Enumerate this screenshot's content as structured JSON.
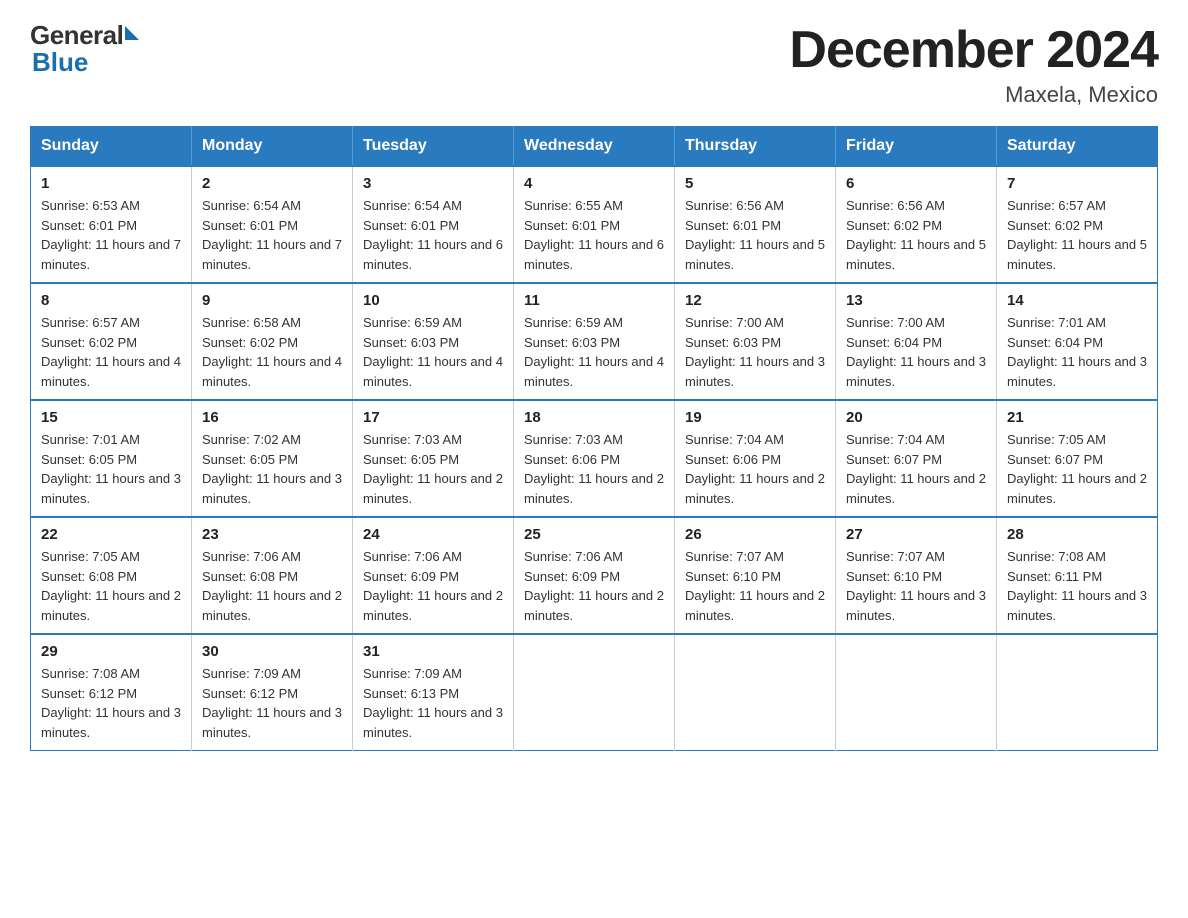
{
  "header": {
    "logo_general": "General",
    "logo_blue": "Blue",
    "title": "December 2024",
    "subtitle": "Maxela, Mexico"
  },
  "days_of_week": [
    "Sunday",
    "Monday",
    "Tuesday",
    "Wednesday",
    "Thursday",
    "Friday",
    "Saturday"
  ],
  "weeks": [
    [
      {
        "day": "1",
        "sunrise": "6:53 AM",
        "sunset": "6:01 PM",
        "daylight": "11 hours and 7 minutes."
      },
      {
        "day": "2",
        "sunrise": "6:54 AM",
        "sunset": "6:01 PM",
        "daylight": "11 hours and 7 minutes."
      },
      {
        "day": "3",
        "sunrise": "6:54 AM",
        "sunset": "6:01 PM",
        "daylight": "11 hours and 6 minutes."
      },
      {
        "day": "4",
        "sunrise": "6:55 AM",
        "sunset": "6:01 PM",
        "daylight": "11 hours and 6 minutes."
      },
      {
        "day": "5",
        "sunrise": "6:56 AM",
        "sunset": "6:01 PM",
        "daylight": "11 hours and 5 minutes."
      },
      {
        "day": "6",
        "sunrise": "6:56 AM",
        "sunset": "6:02 PM",
        "daylight": "11 hours and 5 minutes."
      },
      {
        "day": "7",
        "sunrise": "6:57 AM",
        "sunset": "6:02 PM",
        "daylight": "11 hours and 5 minutes."
      }
    ],
    [
      {
        "day": "8",
        "sunrise": "6:57 AM",
        "sunset": "6:02 PM",
        "daylight": "11 hours and 4 minutes."
      },
      {
        "day": "9",
        "sunrise": "6:58 AM",
        "sunset": "6:02 PM",
        "daylight": "11 hours and 4 minutes."
      },
      {
        "day": "10",
        "sunrise": "6:59 AM",
        "sunset": "6:03 PM",
        "daylight": "11 hours and 4 minutes."
      },
      {
        "day": "11",
        "sunrise": "6:59 AM",
        "sunset": "6:03 PM",
        "daylight": "11 hours and 4 minutes."
      },
      {
        "day": "12",
        "sunrise": "7:00 AM",
        "sunset": "6:03 PM",
        "daylight": "11 hours and 3 minutes."
      },
      {
        "day": "13",
        "sunrise": "7:00 AM",
        "sunset": "6:04 PM",
        "daylight": "11 hours and 3 minutes."
      },
      {
        "day": "14",
        "sunrise": "7:01 AM",
        "sunset": "6:04 PM",
        "daylight": "11 hours and 3 minutes."
      }
    ],
    [
      {
        "day": "15",
        "sunrise": "7:01 AM",
        "sunset": "6:05 PM",
        "daylight": "11 hours and 3 minutes."
      },
      {
        "day": "16",
        "sunrise": "7:02 AM",
        "sunset": "6:05 PM",
        "daylight": "11 hours and 3 minutes."
      },
      {
        "day": "17",
        "sunrise": "7:03 AM",
        "sunset": "6:05 PM",
        "daylight": "11 hours and 2 minutes."
      },
      {
        "day": "18",
        "sunrise": "7:03 AM",
        "sunset": "6:06 PM",
        "daylight": "11 hours and 2 minutes."
      },
      {
        "day": "19",
        "sunrise": "7:04 AM",
        "sunset": "6:06 PM",
        "daylight": "11 hours and 2 minutes."
      },
      {
        "day": "20",
        "sunrise": "7:04 AM",
        "sunset": "6:07 PM",
        "daylight": "11 hours and 2 minutes."
      },
      {
        "day": "21",
        "sunrise": "7:05 AM",
        "sunset": "6:07 PM",
        "daylight": "11 hours and 2 minutes."
      }
    ],
    [
      {
        "day": "22",
        "sunrise": "7:05 AM",
        "sunset": "6:08 PM",
        "daylight": "11 hours and 2 minutes."
      },
      {
        "day": "23",
        "sunrise": "7:06 AM",
        "sunset": "6:08 PM",
        "daylight": "11 hours and 2 minutes."
      },
      {
        "day": "24",
        "sunrise": "7:06 AM",
        "sunset": "6:09 PM",
        "daylight": "11 hours and 2 minutes."
      },
      {
        "day": "25",
        "sunrise": "7:06 AM",
        "sunset": "6:09 PM",
        "daylight": "11 hours and 2 minutes."
      },
      {
        "day": "26",
        "sunrise": "7:07 AM",
        "sunset": "6:10 PM",
        "daylight": "11 hours and 2 minutes."
      },
      {
        "day": "27",
        "sunrise": "7:07 AM",
        "sunset": "6:10 PM",
        "daylight": "11 hours and 3 minutes."
      },
      {
        "day": "28",
        "sunrise": "7:08 AM",
        "sunset": "6:11 PM",
        "daylight": "11 hours and 3 minutes."
      }
    ],
    [
      {
        "day": "29",
        "sunrise": "7:08 AM",
        "sunset": "6:12 PM",
        "daylight": "11 hours and 3 minutes."
      },
      {
        "day": "30",
        "sunrise": "7:09 AM",
        "sunset": "6:12 PM",
        "daylight": "11 hours and 3 minutes."
      },
      {
        "day": "31",
        "sunrise": "7:09 AM",
        "sunset": "6:13 PM",
        "daylight": "11 hours and 3 minutes."
      },
      null,
      null,
      null,
      null
    ]
  ]
}
